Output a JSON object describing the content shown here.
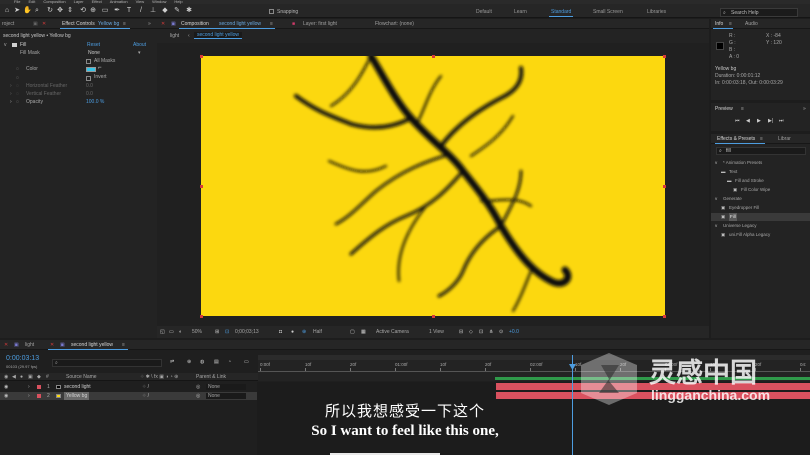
{
  "menu": {
    "items": [
      "File",
      "Edit",
      "Composition",
      "Layer",
      "Effect",
      "Animation",
      "View",
      "Window",
      "Help"
    ]
  },
  "toolbar": {
    "snapping_label": "Snapping",
    "workspaces": [
      "Default",
      "Learn",
      "Standard",
      "Small Screen",
      "Libraries"
    ],
    "active_workspace": "Standard",
    "search_placeholder": "Search Help"
  },
  "left_panel": {
    "tab_project": "roject",
    "tab_effect_controls": "Effect Controls",
    "tab_effect_target": "Yellow bg",
    "layer_path": "second light yellow • Yellow bg",
    "effect_name": "Fill",
    "reset_label": "Reset",
    "about_label": "About",
    "fill_mask_label": "Fill Mask",
    "fill_mask_value": "None",
    "all_masks_label": "All Masks",
    "color_label": "Color",
    "invert_label": "Invert",
    "h_feather_label": "Horizontal Feather",
    "h_feather_value": "0.0",
    "v_feather_label": "Vertical Feather",
    "v_feather_value": "0.0",
    "opacity_label": "Opacity",
    "opacity_value": "100.0 %"
  },
  "comp_panel": {
    "tab_composition": "Composition",
    "tab_comp_name": "second light yellow",
    "tab_layer": "Layer: first light",
    "tab_flowchart": "Flowchart: (none)",
    "breadcrumbs": [
      "light",
      "second light yellow"
    ],
    "zoom": "50%",
    "timecode": "0;00;03;13",
    "resolution": "Half",
    "camera": "Active Camera",
    "view": "1 View",
    "exposure": "+0.0"
  },
  "info_panel": {
    "tab_info": "Info",
    "tab_audio": "Audio",
    "r_label": "R :",
    "g_label": "G :",
    "b_label": "B :",
    "a_label": "A : 0",
    "x_value": "X : -84",
    "y_value": "Y : 120",
    "layer_name": "Yellow bg",
    "duration": "Duration: 0:00:01:12",
    "in_out": "In: 0:00:03:18, Out: 0:00:03:29"
  },
  "preview_panel": {
    "title": "Preview"
  },
  "effects_panel": {
    "title": "Effects & Presets",
    "tab_libraries": "Librar",
    "search_value": "fill",
    "tree": [
      {
        "label": "* Animation Presets",
        "depth": 0,
        "icon": "chevron-down-icon"
      },
      {
        "label": "Text",
        "depth": 1,
        "icon": "folder-icon"
      },
      {
        "label": "Fill and Stroke",
        "depth": 2,
        "icon": "folder-icon"
      },
      {
        "label": "Fill Color Wipe",
        "depth": 3,
        "icon": "preset-icon"
      },
      {
        "label": "Generate",
        "depth": 0,
        "icon": "chevron-down-icon"
      },
      {
        "label": "Eyedropper Fill",
        "depth": 1,
        "icon": "effect-icon"
      },
      {
        "label": "Fill",
        "depth": 1,
        "icon": "effect-icon",
        "selected": true
      },
      {
        "label": "Universe Legacy",
        "depth": 0,
        "icon": "chevron-down-icon"
      },
      {
        "label": "uni.Fill Alpha Legacy",
        "depth": 1,
        "icon": "effect-icon"
      }
    ]
  },
  "timeline": {
    "tab_light": "light",
    "tab_second": "second light yellow",
    "current_time": "0:00:03:13",
    "frame_info": "00103 (29.97 fps)",
    "search_placeholder": "",
    "col_source_name": "Source Name",
    "col_parent": "Parent & Link",
    "layers": [
      {
        "num": "1",
        "name": "second light",
        "color": "#000000",
        "parent": "None"
      },
      {
        "num": "2",
        "name": "Yellow bg",
        "color": "#fcd80f",
        "parent": "None",
        "selected": true
      }
    ],
    "ruler_labels": [
      "0:00f",
      "10f",
      "20f",
      "01:00f",
      "10f",
      "20f",
      "02:00f",
      "10f",
      "20f",
      "03:00f",
      "10f",
      "20f",
      "04:"
    ]
  },
  "subtitles": {
    "chinese": "所以我想感受一下这个",
    "english": "So I want to feel like this one,"
  },
  "watermark": {
    "cn": "灵感中国",
    "url": "lingganchina.com"
  },
  "colors": {
    "accent": "#4d9de0",
    "canvas": "#fcd80f",
    "layer_bar": "#d9515f"
  }
}
